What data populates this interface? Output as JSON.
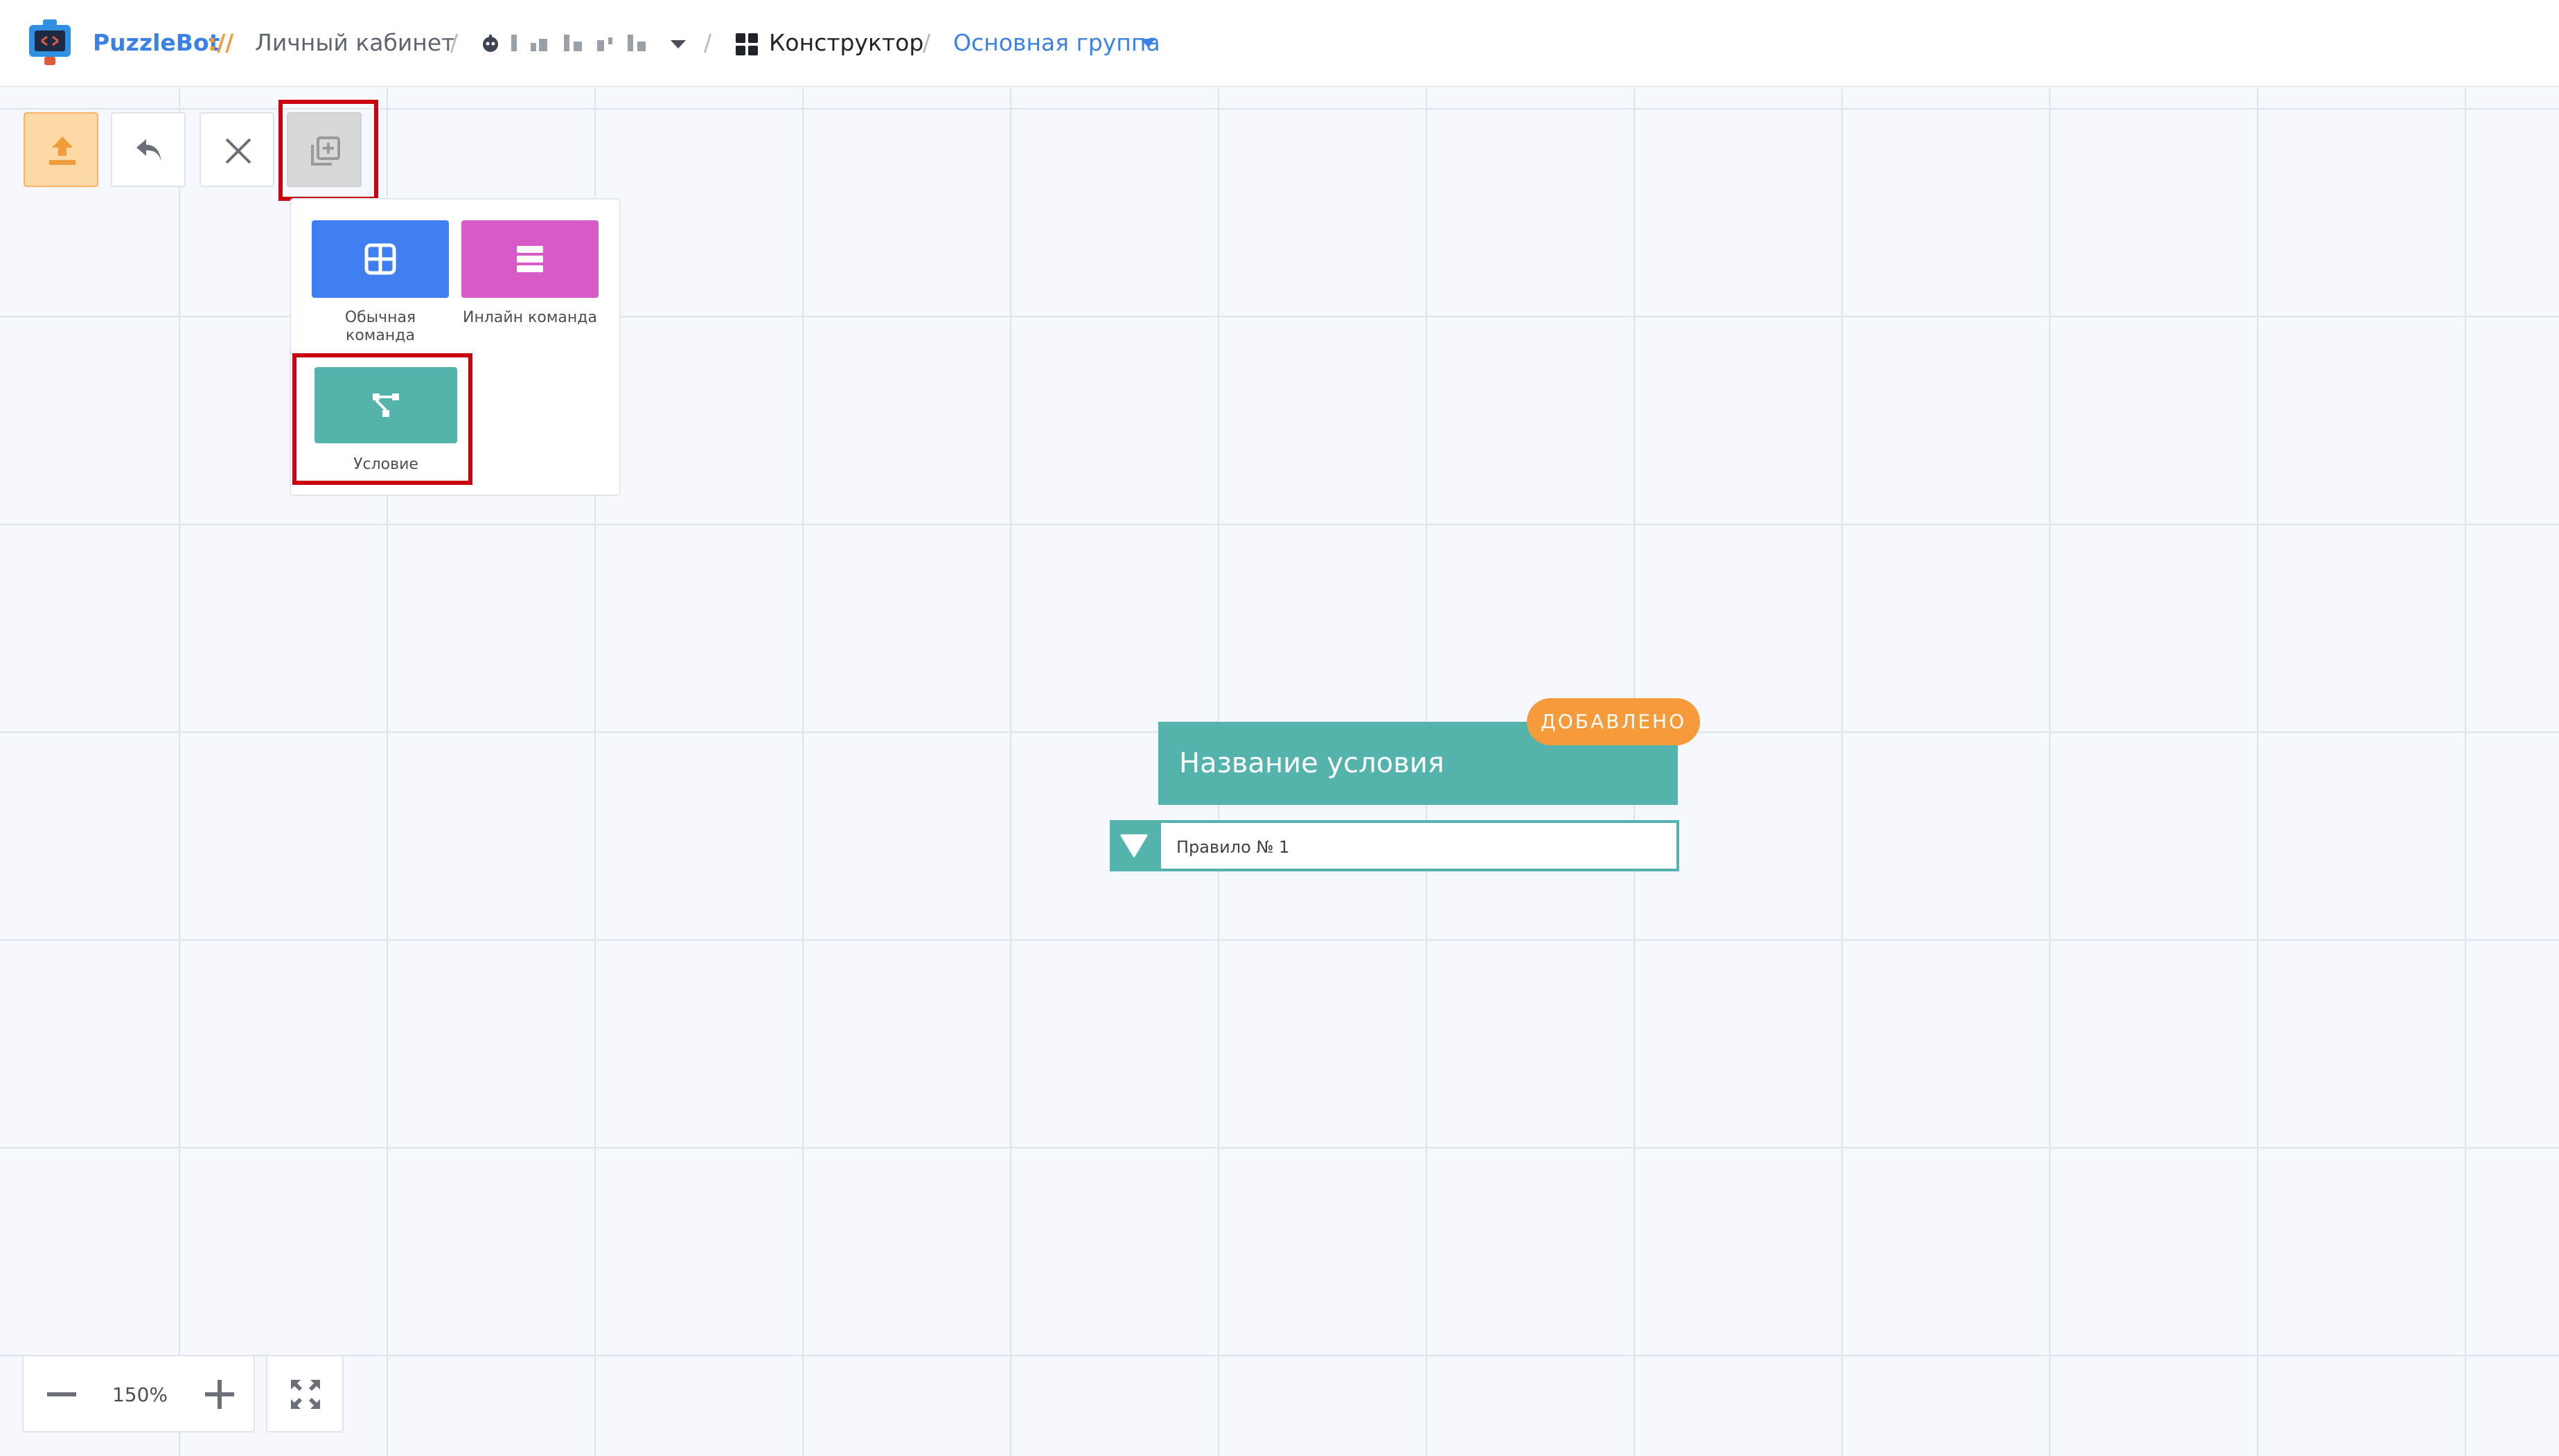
{
  "header": {
    "brand": "PuzzleBot",
    "brand_separator": "://",
    "breadcrumb_cabinet": "Личный кабинет",
    "breadcrumb_separator": "/",
    "breadcrumb_constructor": "Конструктор",
    "breadcrumb_group": "Основная группа"
  },
  "toolbar": {
    "icons": [
      "upload-icon",
      "undo-icon",
      "close-icon",
      "add-block-icon"
    ]
  },
  "add_menu": {
    "items": [
      {
        "label": "Обычная\nкоманда",
        "icon": "grid-icon",
        "color": "#3f7ff2"
      },
      {
        "label": "Инлайн команда",
        "icon": "list-icon",
        "color": "#d95bc8"
      },
      {
        "label": "Условие",
        "icon": "branch-icon",
        "color": "#55b3ad"
      }
    ]
  },
  "node": {
    "title": "Название условия",
    "badge": "ДОБАВЛЕНО",
    "rule": "Правило № 1",
    "color": "#55b3ad",
    "badge_color": "#f59b3c"
  },
  "zoom": {
    "value": "150%"
  },
  "colors": {
    "accent": "#3a82e6",
    "highlight": "#c8000f"
  }
}
